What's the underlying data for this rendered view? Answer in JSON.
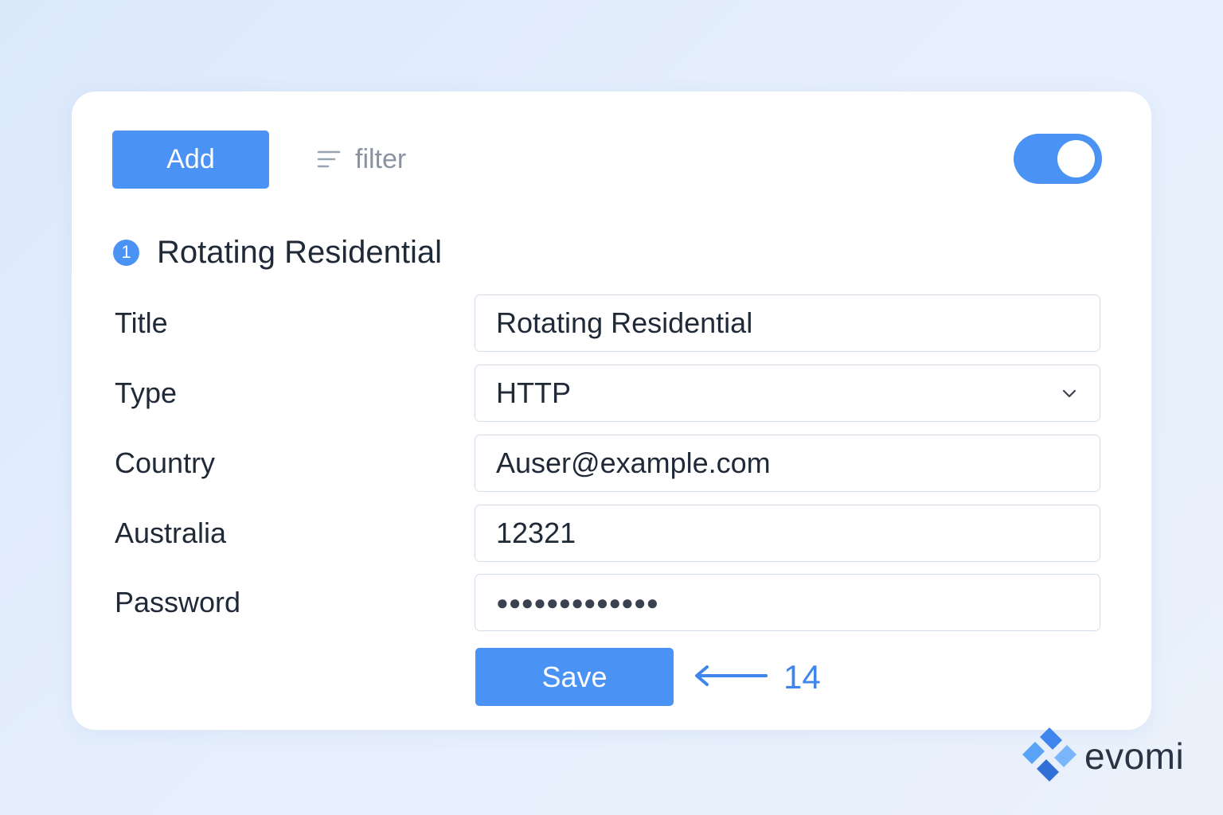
{
  "toolbar": {
    "add_label": "Add",
    "filter_label": "filter",
    "filter_icon": "filter-lines-icon",
    "toggle_on": true
  },
  "section": {
    "step_number": "1",
    "title": "Rotating Residential"
  },
  "form": {
    "rows": [
      {
        "label": "Title",
        "value": "Rotating Residential",
        "kind": "text"
      },
      {
        "label": "Type",
        "value": "HTTP",
        "kind": "select"
      },
      {
        "label": "Country",
        "value": "Auser@example.com",
        "kind": "text"
      },
      {
        "label": "Australia",
        "value": "12321",
        "kind": "text"
      },
      {
        "label": "Password",
        "value": "●●●●●●●●●●●●●",
        "kind": "password"
      }
    ],
    "save_label": "Save"
  },
  "annotation": {
    "number": "14",
    "icon": "arrow-left-icon"
  },
  "brand": {
    "name": "evomi",
    "logo_icon": "evomi-logo-icon"
  },
  "colors": {
    "accent": "#4a92f4",
    "background": "#e3edfb",
    "card": "#ffffff",
    "text": "#1f2937",
    "border": "#d3dde9"
  }
}
